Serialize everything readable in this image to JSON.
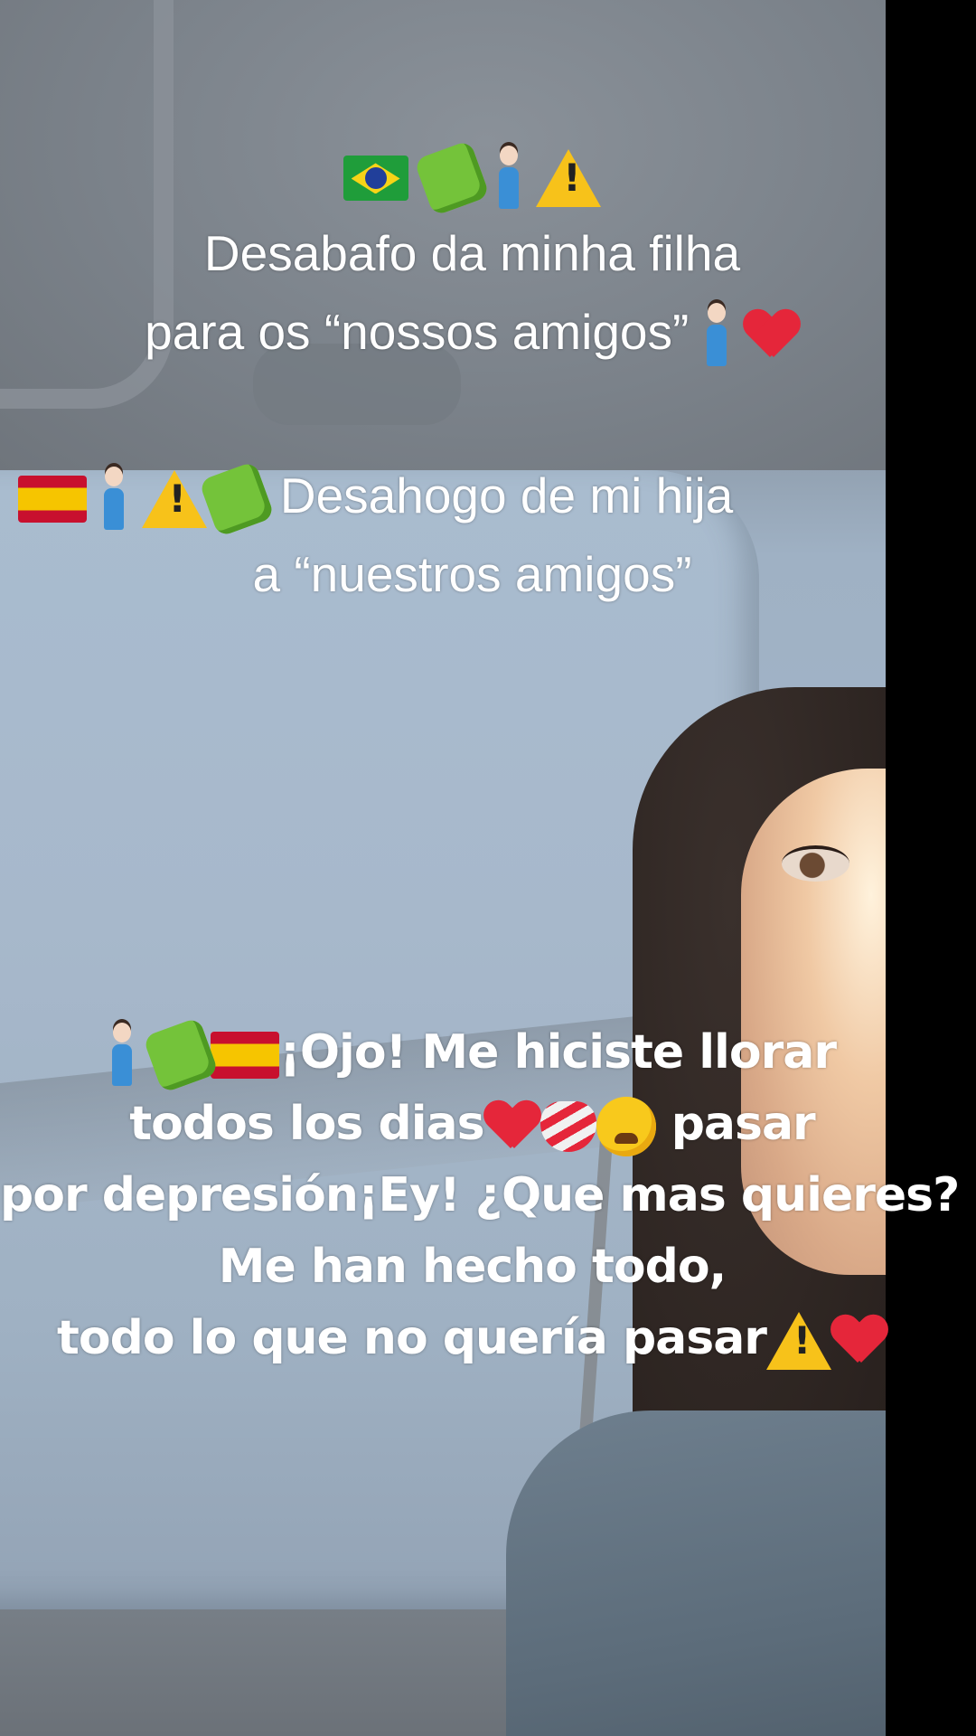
{
  "caption_portuguese": {
    "line1": "Desabafo da minha filha",
    "line2": "para os “nossos amigos”"
  },
  "caption_spanish": {
    "line1": "Desahogo de mi hija",
    "line2": "a “nuestros amigos”"
  },
  "caption_lyrics": {
    "line1": "¡Ojo! Me hiciste llorar",
    "line2a": "todos los dias",
    "line2b": "pasar",
    "line3": "por depresión¡Ey! ¿Que mas quieres?",
    "line4": "Me han hecho todo,",
    "line5": "todo lo que no quería pasar"
  },
  "icons": [
    "brazil-flag-icon",
    "puzzle-piece-icon",
    "woman-icon",
    "warning-icon",
    "broken-heart-icon",
    "spain-flag-icon",
    "mending-heart-icon",
    "tired-face-icon"
  ],
  "colors": {
    "text": "#ffffff",
    "side_bar": "#000000"
  }
}
